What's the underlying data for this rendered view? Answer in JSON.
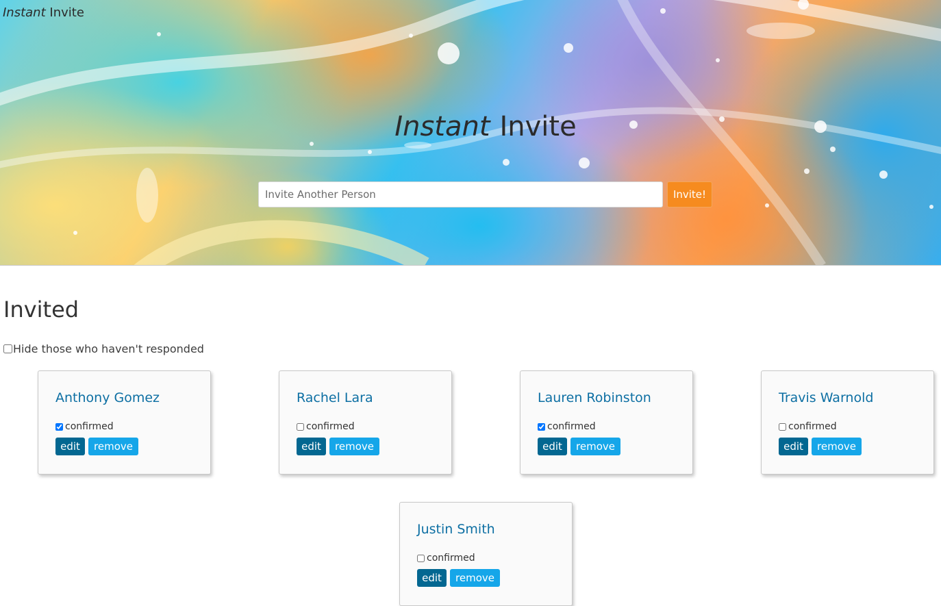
{
  "header": {
    "brand_italic": "Instant",
    "brand_normal": "Invite",
    "title_italic": "Instant",
    "title_normal": "Invite",
    "invite_placeholder": "Invite Another Person",
    "invite_value": "",
    "invite_button_label": "Invite!"
  },
  "main": {
    "section_title": "Invited",
    "filter_label": "Hide those who haven't responded",
    "filter_checked": false
  },
  "guests": [
    {
      "name": "Anthony Gomez",
      "confirmed_label": "confirmed",
      "confirmed": true,
      "edit_label": "edit",
      "remove_label": "remove"
    },
    {
      "name": "Rachel Lara",
      "confirmed_label": "confirmed",
      "confirmed": false,
      "edit_label": "edit",
      "remove_label": "remove"
    },
    {
      "name": "Lauren Robinston",
      "confirmed_label": "confirmed",
      "confirmed": true,
      "edit_label": "edit",
      "remove_label": "remove"
    },
    {
      "name": "Travis Warnold",
      "confirmed_label": "confirmed",
      "confirmed": false,
      "edit_label": "edit",
      "remove_label": "remove"
    },
    {
      "name": "Justin Smith",
      "confirmed_label": "confirmed",
      "confirmed": false,
      "edit_label": "edit",
      "remove_label": "remove"
    }
  ],
  "colors": {
    "invite_button": "#f68b1f",
    "guest_name": "#0d6fa3",
    "edit_button": "#036791",
    "remove_button": "#15a6e9"
  }
}
